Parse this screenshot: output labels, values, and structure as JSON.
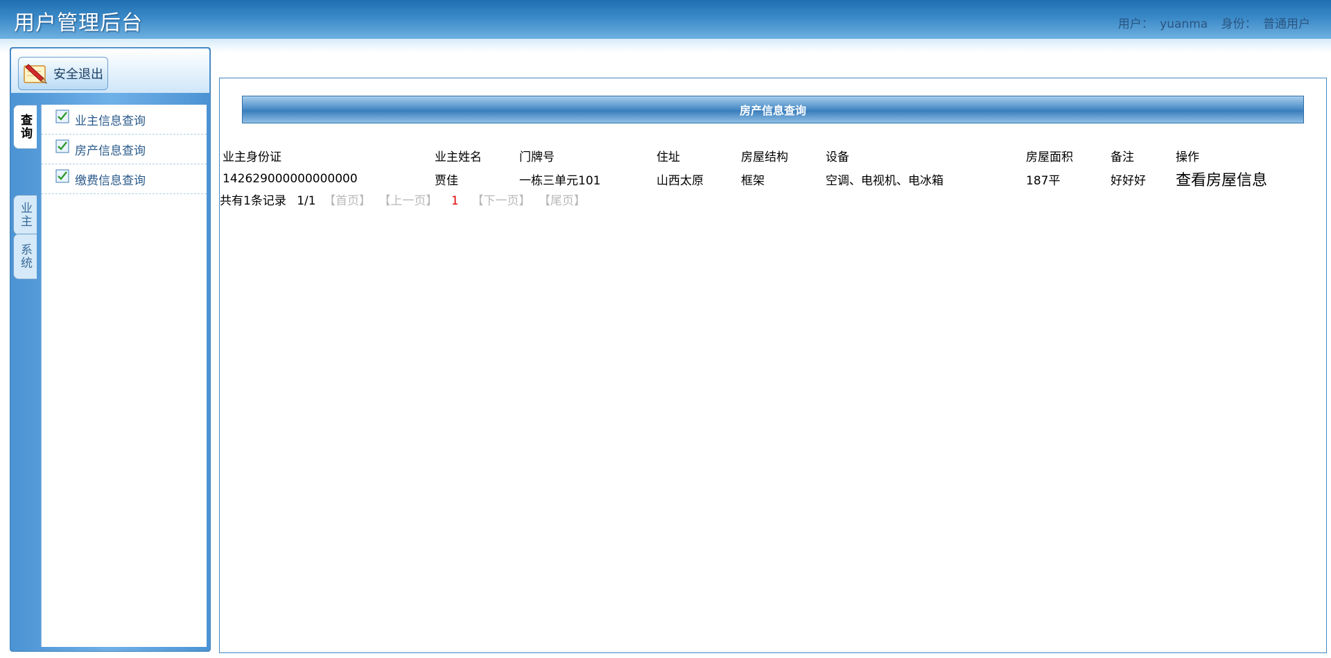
{
  "header": {
    "title": "用户管理后台",
    "user_label": "用户：",
    "username": "yuanma",
    "role_label": "身份：",
    "role": "普通用户"
  },
  "sidebar": {
    "logout_label": "安全退出",
    "tabs": [
      {
        "label": "查询",
        "active": true
      },
      {
        "label": "业主",
        "active": false
      },
      {
        "label": "系统",
        "active": false
      }
    ],
    "items": [
      {
        "label": "业主信息查询"
      },
      {
        "label": "房产信息查询"
      },
      {
        "label": "缴费信息查询"
      }
    ]
  },
  "main": {
    "panel_title": "房产信息查询",
    "columns": [
      "业主身份证",
      "业主姓名",
      "门牌号",
      "住址",
      "房屋结构",
      "设备",
      "房屋面积",
      "备注",
      "操作"
    ],
    "rows": [
      [
        "142629000000000000",
        "贾佳",
        "一栋三单元101",
        "山西太原",
        "框架",
        "空调、电视机、电冰箱",
        "187平",
        "好好好",
        "查看房屋信息"
      ]
    ],
    "pager": {
      "summary": "共有1条记录",
      "page_info": "1/1",
      "first": "【首页】",
      "prev": "【上一页】",
      "current": "1",
      "next": "【下一页】",
      "last": "【尾页】"
    }
  }
}
